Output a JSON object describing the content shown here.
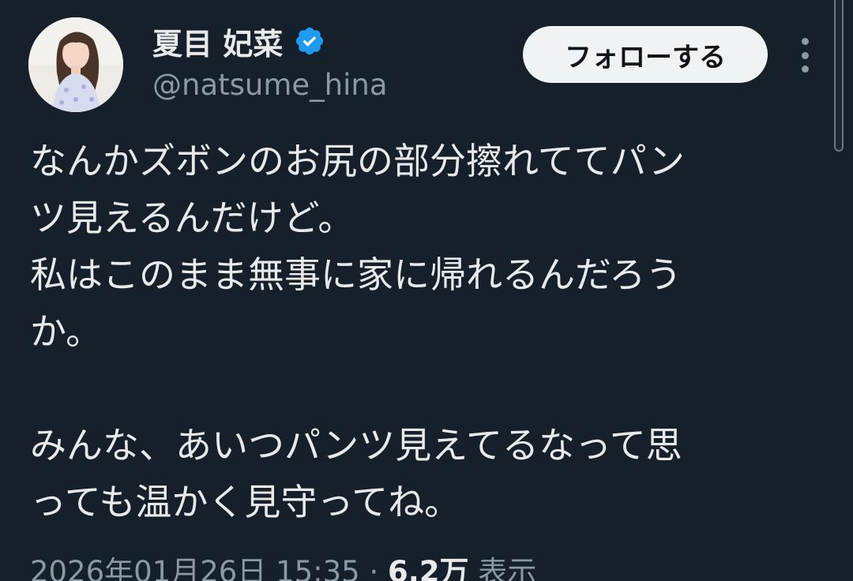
{
  "author": {
    "display_name": "夏目 妃菜",
    "handle": "@natsume_hina",
    "verified": true
  },
  "actions": {
    "follow_label": "フォローする",
    "more_icon": "more-vertical-icon"
  },
  "tweet": {
    "lines": [
      "なんかズボンのお尻の部分擦れててパン",
      "ツ見えるんだけど。",
      "私はこのまま無事に家に帰れるんだろう",
      "か。",
      "",
      "みんな、あいつパンツ見えてるなって思",
      "っても温かく見守ってね。"
    ],
    "timestamp": "2026年01月26日 15:35",
    "separator": "·",
    "views_count": "6.2万",
    "views_label": "表示"
  },
  "colors": {
    "background": "#15202b",
    "text_primary": "#e7e9ea",
    "text_secondary": "#8b98a5",
    "verified_blue": "#1d9bf0",
    "follow_button_bg": "#eff3f4"
  }
}
